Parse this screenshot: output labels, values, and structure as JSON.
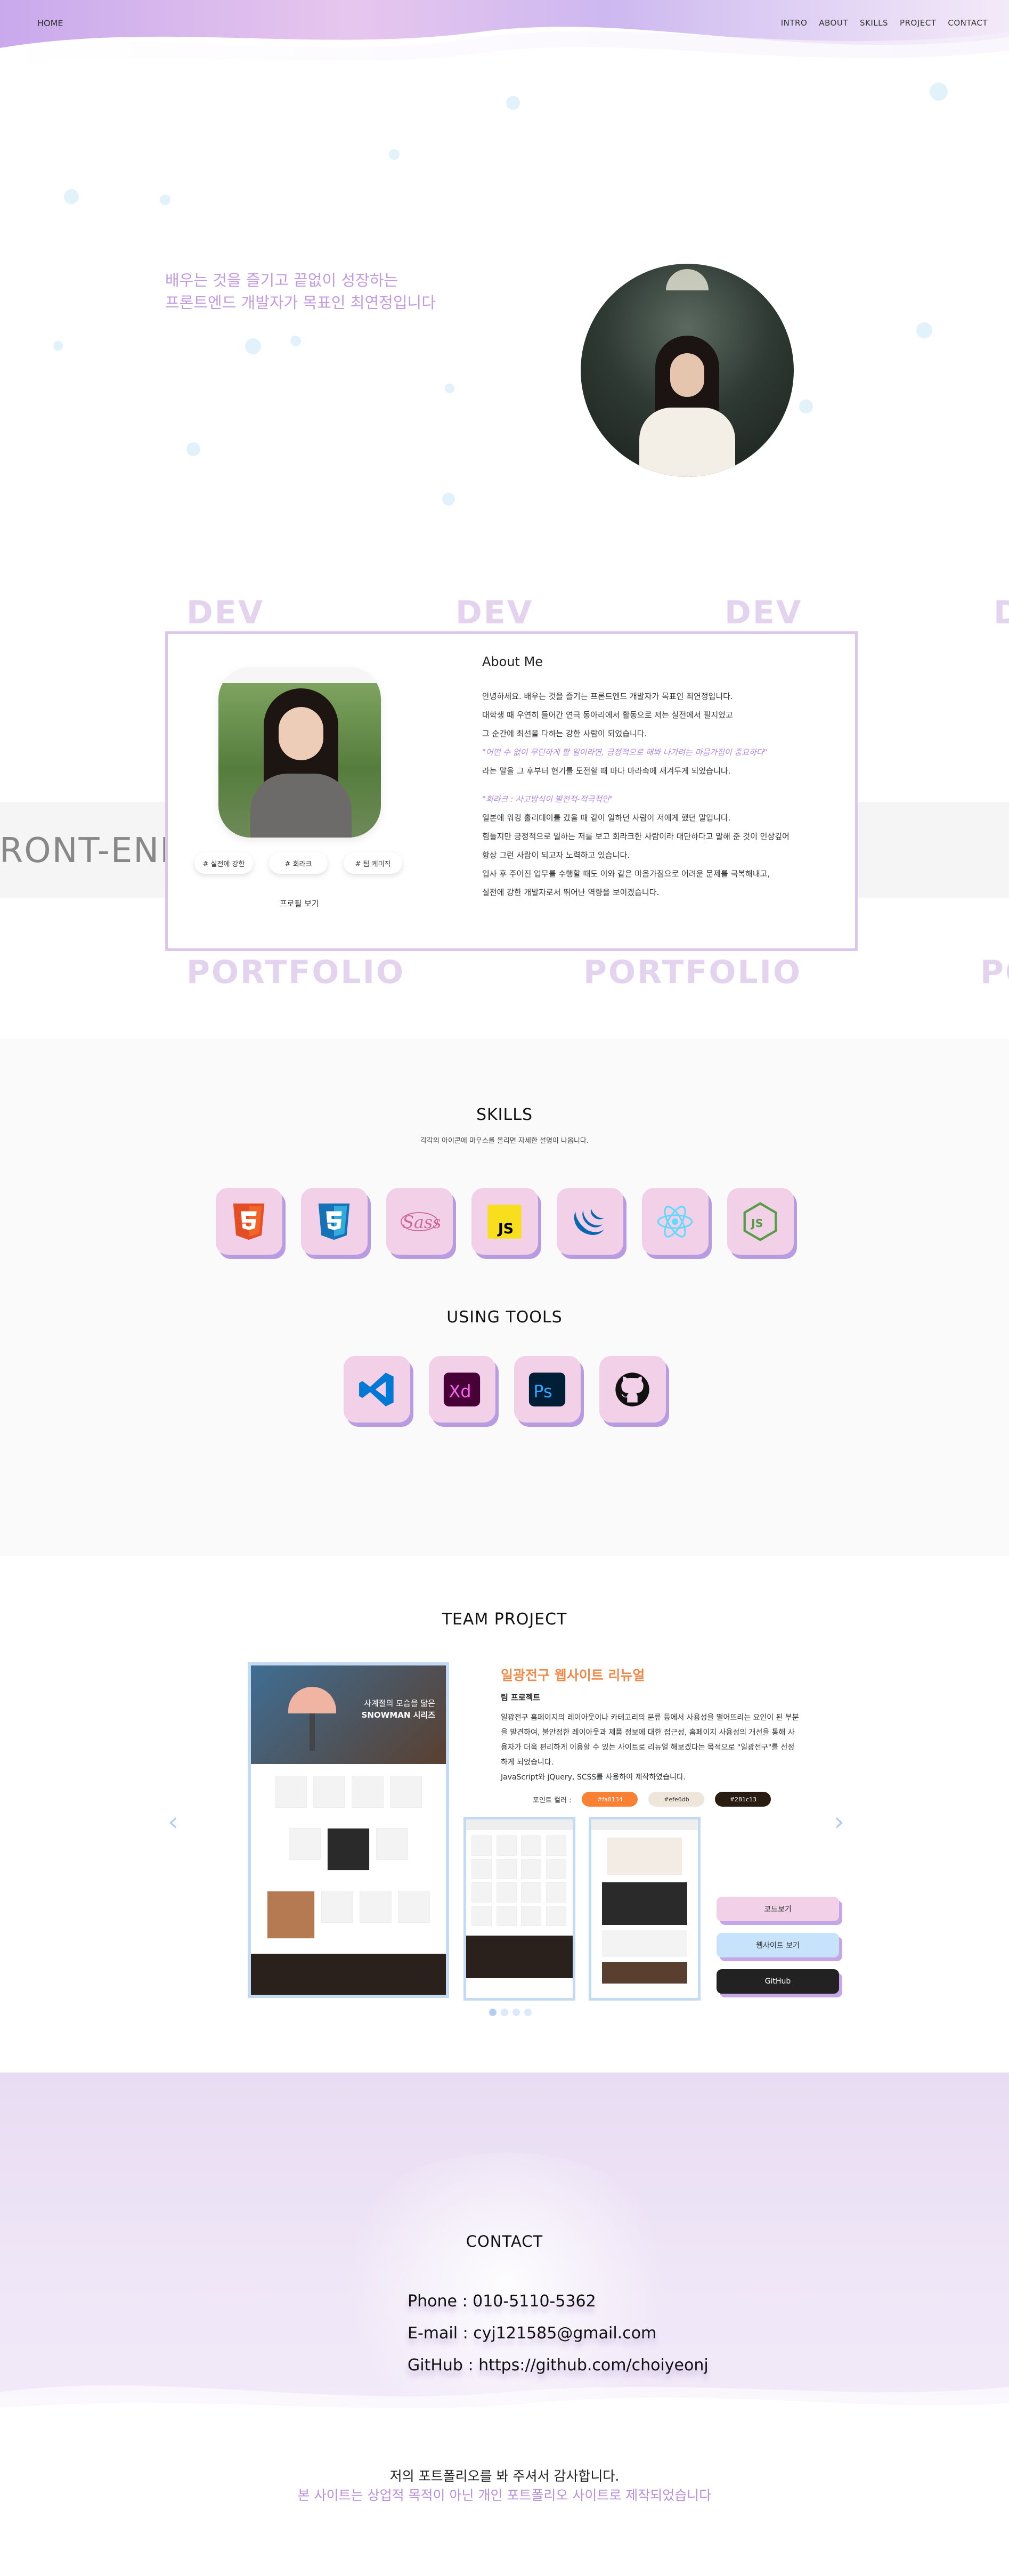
{
  "header": {
    "home": "HOME",
    "nav": [
      "INTRO",
      "ABOUT",
      "SKILLS",
      "PROJECT",
      "CONTACT"
    ]
  },
  "intro": {
    "line1": "배우는 것을 즐기고 끝없이 성장하는",
    "line2": "프론트엔드 개발자가 목표인 최연정입니다"
  },
  "about": {
    "marquee_word": "DEV",
    "band_text": "FRONT-END",
    "bottom_marquee_word": "PORTFOLIO",
    "title": "About Me",
    "paragraphs": [
      "안녕하세요. 배우는 것을 즐기는 프론트엔드 개발자가 목표인 최연정입니다.",
      "대학생 때 우연히 들어간 연극 동아리에서 활동으로 저는 실전에서 필지었고",
      "그 순간에 최선을 다하는 강한 사람이 되었습니다."
    ],
    "quote1": "\"어떤 수 없이 무딘하게 할 일이라면, 긍정적으로 해봐 나가려는 마음가짐이 중요하다\"",
    "after_quote1": "라는 말을 그 후부터 현기를 도전할 때 마다 마라속에 새겨두게 되었습니다.",
    "quote2": "\"회라크 : 사고방식이 발전적-적극적인\"",
    "paragraphs2": [
      "일본에 워킹 홀리데이를 갔을 때 같이 일하던 사람이 저에게 했던 말입니다.",
      "힘들지만 긍정적으로 일하는 저를 보고 회라크한 사람이라 대단하다고 말해 준 것이 인상깊어",
      "항상 그런 사람이 되고자 노력하고 있습니다.",
      "입사 후 주어진 업무를 수행할 때도 이와 같은 마음가짐으로 어려운 문제를 극복해내고,",
      "실전에 강한 개발자로서 뛰어난 역량을 보이겠습니다."
    ],
    "tags": [
      "# 실전에 강한",
      "# 회라크",
      "# 팀 케미직"
    ],
    "profile_link": "프로필 보기"
  },
  "skills": {
    "title": "SKILLS",
    "subtitle": "각각의 아이콘에 마우스를 올리면 자세한 설명이 나옵니다.",
    "icons": [
      "html5-icon",
      "css3-icon",
      "sass-icon",
      "javascript-icon",
      "jquery-icon",
      "react-icon",
      "nodejs-icon"
    ],
    "tools_title": "USING TOOLS",
    "tools": [
      "vscode-icon",
      "adobe-xd-icon",
      "photoshop-icon",
      "github-icon"
    ]
  },
  "team": {
    "title": "TEAM PROJECT",
    "project_title": "일광전구 웹사이트 리뉴얼",
    "project_type": "팀 프로젝트",
    "description": "일광전구 홈페이지의 레이아웃이나 카테고리의 분류 등에서 사용성을 떨어뜨리는 요인이 된 부분을 발견하여, 불안정한 레이아웃과 제품 정보에 대한 접근성, 홈페이지 사용성의 개선을 통해 사용자가 더욱 편리하게 이용할 수 있는 사이트로 리뉴얼 해보겠다는 목적으로 \"일광전구\"를 선정하게 되었습니다.",
    "tech": "JavaScript와 jQuery, SCSS를 사용하여 제작하였습니다.",
    "point_label": "포인트 컬러 :",
    "colors": [
      {
        "label": "#fa8134",
        "bg": "#fa8134",
        "fg": "#ffffff"
      },
      {
        "label": "#efe6db",
        "bg": "#efe6db",
        "fg": "#333333"
      },
      {
        "label": "#281c13",
        "bg": "#281c13",
        "fg": "#ffffff"
      }
    ],
    "hero_text_1": "사계절의 모습을 닮은",
    "hero_text_2": "SNOWMAN 시리즈",
    "buttons": [
      "코드보기",
      "웹사이트 보기",
      "GitHub"
    ],
    "prev": "‹",
    "next": "›"
  },
  "contact": {
    "title": "CONTACT",
    "phone": "Phone : 010-5110-5362",
    "email": "E-mail : cyj121585@gmail.com",
    "github": "GitHub : https://github.com/choiyeonj",
    "thanks1": "저의 포트폴리오를 봐 주셔서 감사합니다.",
    "thanks2": "본 사이트는 상업적 목적이 아닌 개인 포트폴리오 사이트로 제작되었습니다"
  },
  "colors": {
    "accent_purple": "#c29be0",
    "tile_pink": "#f1d0e8",
    "tile_shadow": "#b89ce2",
    "orange": "#f08a4b"
  }
}
